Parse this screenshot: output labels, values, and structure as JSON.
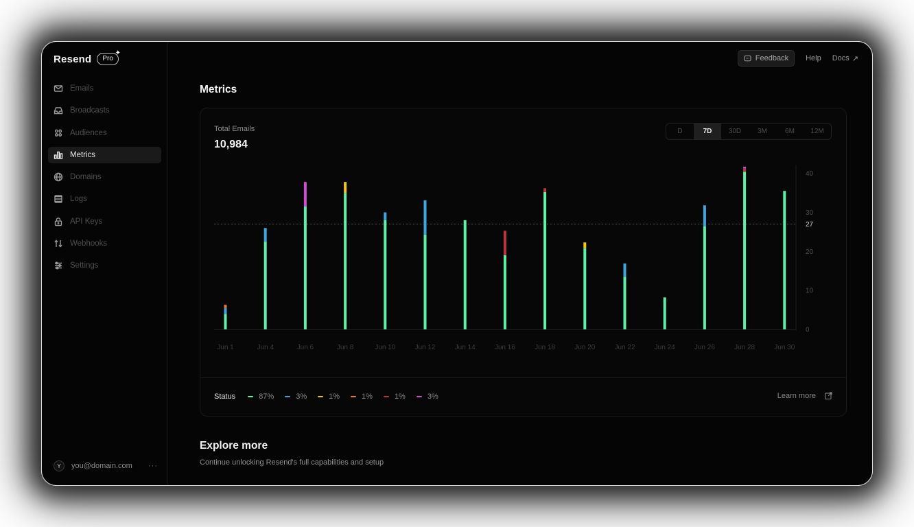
{
  "brand": {
    "name": "Resend",
    "plan": "Pro",
    "plan_star": "✦"
  },
  "sidebar": {
    "items": [
      {
        "label": "Emails",
        "icon": "mail-icon",
        "active": false
      },
      {
        "label": "Broadcasts",
        "icon": "inbox-icon",
        "active": false
      },
      {
        "label": "Audiences",
        "icon": "users-icon",
        "active": false
      },
      {
        "label": "Metrics",
        "icon": "bar-chart-icon",
        "active": true
      },
      {
        "label": "Domains",
        "icon": "globe-icon",
        "active": false
      },
      {
        "label": "Logs",
        "icon": "list-icon",
        "active": false
      },
      {
        "label": "API Keys",
        "icon": "lock-icon",
        "active": false
      },
      {
        "label": "Webhooks",
        "icon": "arrows-icon",
        "active": false
      },
      {
        "label": "Settings",
        "icon": "sliders-icon",
        "active": false
      }
    ]
  },
  "user": {
    "initial": "Y",
    "email": "you@domain.com",
    "more": "···"
  },
  "topbar": {
    "feedback": "Feedback",
    "help": "Help",
    "docs": "Docs",
    "docs_arrow": "↗"
  },
  "page": {
    "title": "Metrics"
  },
  "card": {
    "label": "Total Emails",
    "value": "10,984",
    "ranges": [
      "D",
      "7D",
      "30D",
      "3M",
      "6M",
      "12M"
    ],
    "active_range": "7D"
  },
  "status": {
    "label": "Status",
    "items": [
      {
        "color": "#5ef0a8",
        "value": "87%"
      },
      {
        "color": "#3ea6dc",
        "value": "3%"
      },
      {
        "color": "#f0c419",
        "value": "1%"
      },
      {
        "color": "#f07a2a",
        "value": "1%"
      },
      {
        "color": "#b8383e",
        "value": "1%"
      },
      {
        "color": "#d04cd0",
        "value": "3%"
      }
    ],
    "learn_more": "Learn more"
  },
  "explore": {
    "title": "Explore more",
    "subtitle": "Continue unlocking Resend's full capabilities and setup"
  },
  "chart_data": {
    "type": "bar",
    "stacked": true,
    "x_labels": [
      "Jun 1",
      "Jun 4",
      "Jun 6",
      "Jun 8",
      "Jun 10",
      "Jun 12",
      "Jun 14",
      "Jun 16",
      "Jun 18",
      "Jun 20",
      "Jun 22",
      "Jun 24",
      "Jun 26",
      "Jun 28",
      "Jun 30"
    ],
    "y_ticks": [
      0,
      10,
      20,
      30,
      40
    ],
    "ylim": [
      0,
      41
    ],
    "reference_line": {
      "value": 27,
      "label": "27",
      "style": "dotted"
    },
    "series_colors": {
      "green": "#5ef0a8",
      "blue": "#3ea6dc",
      "yellow": "#f0c419",
      "orange": "#f07a2a",
      "red": "#b8383e",
      "magenta": "#d04cd0"
    },
    "bars": [
      [
        {
          "c": "green",
          "v": 4
        },
        {
          "c": "blue",
          "v": 1.5
        },
        {
          "c": "orange",
          "v": 0.8
        }
      ],
      [
        {
          "c": "green",
          "v": 22.5
        },
        {
          "c": "blue",
          "v": 3.5
        }
      ],
      [
        {
          "c": "green",
          "v": 31.5
        },
        {
          "c": "magenta",
          "v": 6.3
        }
      ],
      [
        {
          "c": "green",
          "v": 35
        },
        {
          "c": "yellow",
          "v": 2.8
        }
      ],
      [
        {
          "c": "green",
          "v": 28
        },
        {
          "c": "blue",
          "v": 2
        }
      ],
      [
        {
          "c": "green",
          "v": 24.3
        },
        {
          "c": "blue",
          "v": 8.8
        }
      ],
      [
        {
          "c": "green",
          "v": 28
        }
      ],
      [
        {
          "c": "green",
          "v": 19
        },
        {
          "c": "red",
          "v": 6.3
        }
      ],
      [
        {
          "c": "green",
          "v": 35.2
        },
        {
          "c": "red",
          "v": 1
        }
      ],
      [
        {
          "c": "green",
          "v": 20.8
        },
        {
          "c": "yellow",
          "v": 1.5
        }
      ],
      [
        {
          "c": "green",
          "v": 13.5
        },
        {
          "c": "blue",
          "v": 3.4
        }
      ],
      [
        {
          "c": "green",
          "v": 8.2
        }
      ],
      [
        {
          "c": "green",
          "v": 26.4
        },
        {
          "c": "blue",
          "v": 5.4
        }
      ],
      [
        {
          "c": "green",
          "v": 40.4
        },
        {
          "c": "red",
          "v": 0.9
        },
        {
          "c": "magenta",
          "v": 0.4
        }
      ],
      [
        {
          "c": "green",
          "v": 35.5
        }
      ]
    ]
  }
}
